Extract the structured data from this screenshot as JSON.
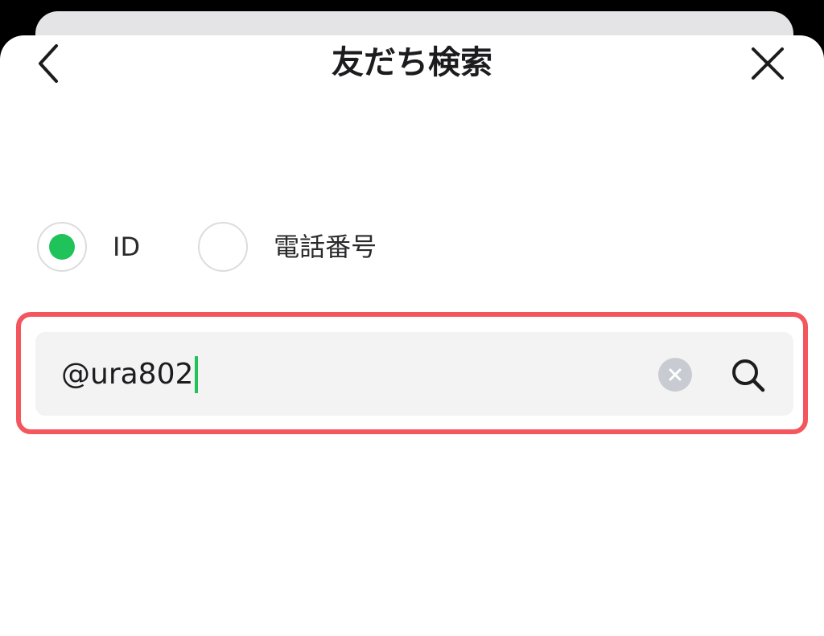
{
  "header": {
    "title": "友だち検索",
    "back_icon": "chevron-left-icon",
    "close_icon": "close-icon"
  },
  "search_type": {
    "selected": "ID",
    "options": [
      {
        "label": "ID",
        "selected": true
      },
      {
        "label": "電話番号",
        "selected": false
      }
    ]
  },
  "search": {
    "value": "@ura802",
    "clear_icon": "clear-icon",
    "search_icon": "search-icon"
  },
  "colors": {
    "accent_green": "#20c35a",
    "highlight_red": "#f4565d",
    "field_bg": "#f3f3f4"
  }
}
